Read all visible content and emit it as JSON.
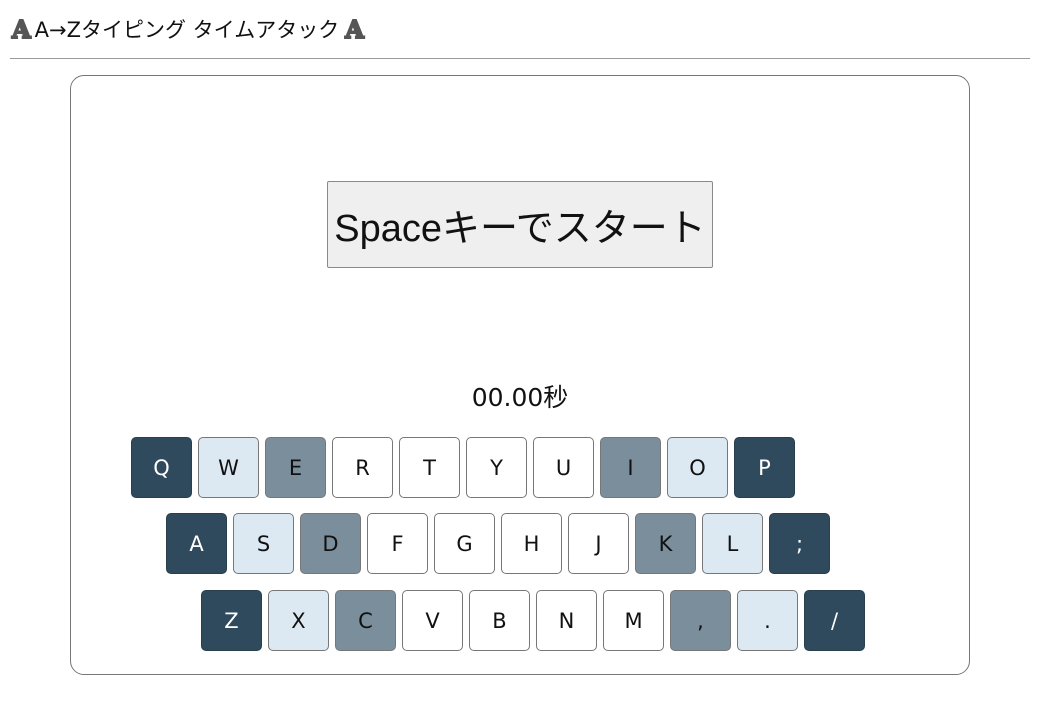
{
  "header": {
    "left_icon": "𝔸",
    "title": "A→Zタイピング タイムアタック",
    "right_icon": "𝔸"
  },
  "start_button": {
    "label": "Spaceキーでスタート"
  },
  "timer": {
    "text": "00.00秒"
  },
  "keyboard": {
    "rows": [
      [
        {
          "label": "Q",
          "finger": "pinky"
        },
        {
          "label": "W",
          "finger": "ring"
        },
        {
          "label": "E",
          "finger": "middle"
        },
        {
          "label": "R",
          "finger": "index"
        },
        {
          "label": "T",
          "finger": "index"
        },
        {
          "label": "Y",
          "finger": "index"
        },
        {
          "label": "U",
          "finger": "index"
        },
        {
          "label": "I",
          "finger": "middle"
        },
        {
          "label": "O",
          "finger": "ring"
        },
        {
          "label": "P",
          "finger": "pinky"
        }
      ],
      [
        {
          "label": "A",
          "finger": "pinky"
        },
        {
          "label": "S",
          "finger": "ring"
        },
        {
          "label": "D",
          "finger": "middle"
        },
        {
          "label": "F",
          "finger": "index"
        },
        {
          "label": "G",
          "finger": "index"
        },
        {
          "label": "H",
          "finger": "index"
        },
        {
          "label": "J",
          "finger": "index"
        },
        {
          "label": "K",
          "finger": "middle"
        },
        {
          "label": "L",
          "finger": "ring"
        },
        {
          "label": ";",
          "finger": "pinky"
        }
      ],
      [
        {
          "label": "Z",
          "finger": "pinky"
        },
        {
          "label": "X",
          "finger": "ring"
        },
        {
          "label": "C",
          "finger": "middle"
        },
        {
          "label": "V",
          "finger": "index"
        },
        {
          "label": "B",
          "finger": "index"
        },
        {
          "label": "N",
          "finger": "index"
        },
        {
          "label": "M",
          "finger": "index"
        },
        {
          "label": ",",
          "finger": "middle"
        },
        {
          "label": ".",
          "finger": "ring"
        },
        {
          "label": "/",
          "finger": "pinky"
        }
      ]
    ]
  },
  "colors": {
    "pinky": "#2e4a5c",
    "ring": "#dce8f2",
    "middle": "#7a8f9b",
    "index": "#ffffff"
  }
}
